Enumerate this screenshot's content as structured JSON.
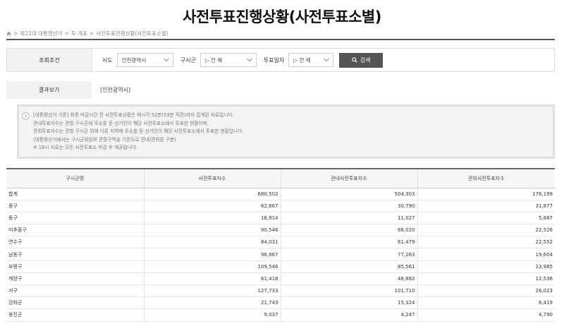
{
  "page": {
    "title": "사전투표진행상황(사전투표소별)"
  },
  "breadcrumb": {
    "items": [
      "제21대 대통령선거",
      "투·개표",
      "사전투표진행상황(사전투표소별)"
    ],
    "separator": ">"
  },
  "search": {
    "section_label": "조회조건",
    "sido_label": "시도",
    "sido_value": "인천광역시",
    "gu_label": "구시군",
    "gu_value": "▷ 전 체",
    "date_label": "투표일자",
    "date_value": "▷ 전 체",
    "button_label": "검색"
  },
  "result": {
    "label": "결과보기",
    "value": "[인천광역시]"
  },
  "notice": {
    "lines": [
      "[대통령선거 기준] 최종 마감시간 전 사전투표상황은 매시각 52분(53분 직전)까지 집계된 자료입니다.",
      "관내투표자수는 관할 구시군에 주소를 둔 선거인이 해당 사전투표소에서 투표한 현황이며,",
      "관외투표자수는 관할 구시군 외에 다른 지역에 주소를 둔 선거인이 해당 사전투표소에서 투표한 현황입니다.",
      "(대통령선거에서는 구시군위원회 관할구역을 기준으로 관내/관외를 구분)",
      "※ 18시 자료는 모든 사전투표소 마감 후 제공됩니다."
    ]
  },
  "table": {
    "headers": [
      "구시군명",
      "사전투표자수",
      "관내사전투표자수",
      "관외사전투표자수"
    ],
    "rows": [
      [
        "합계",
        "680,502",
        "504,303",
        "176,199"
      ],
      [
        "중구",
        "62,667",
        "30,790",
        "31,877"
      ],
      [
        "동구",
        "16,914",
        "11,027",
        "5,887"
      ],
      [
        "미추홀구",
        "90,546",
        "68,020",
        "22,526"
      ],
      [
        "연수구",
        "84,031",
        "61,479",
        "22,552"
      ],
      [
        "남동구",
        "96,867",
        "77,263",
        "19,604"
      ],
      [
        "부평구",
        "109,546",
        "85,561",
        "23,985"
      ],
      [
        "계양구",
        "61,418",
        "48,882",
        "12,536"
      ],
      [
        "서구",
        "127,733",
        "101,710",
        "26,023"
      ],
      [
        "강화군",
        "21,743",
        "15,324",
        "6,419"
      ],
      [
        "옹진군",
        "9,037",
        "4,247",
        "4,790"
      ]
    ]
  },
  "colors": {
    "button_bg": "#555555",
    "label_bg": "#f2f2f2",
    "notice_bg": "#f4f4f4"
  }
}
